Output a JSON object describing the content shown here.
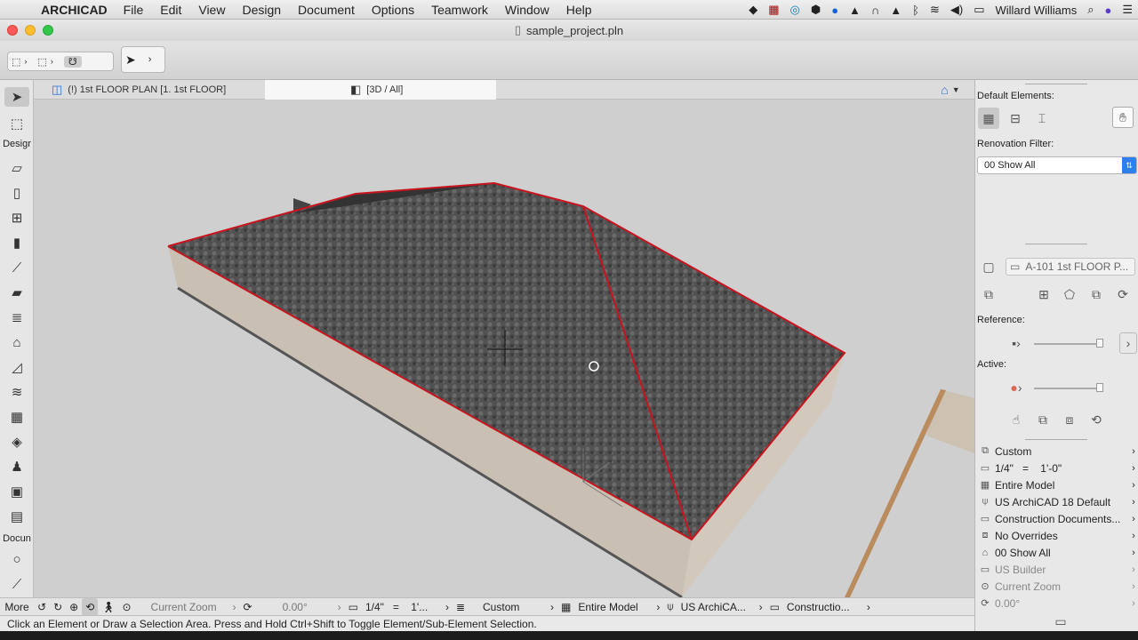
{
  "menubar": {
    "app_name": "ARCHICAD",
    "menus": [
      "File",
      "Edit",
      "View",
      "Design",
      "Document",
      "Options",
      "Teamwork",
      "Window",
      "Help"
    ],
    "user": "Willard Williams"
  },
  "window": {
    "title": "sample_project.pln"
  },
  "tabs": [
    {
      "label": "(!) 1st FLOOR PLAN [1. 1st FLOOR]"
    },
    {
      "label": "[3D / All]"
    }
  ],
  "toolbox": {
    "design_label": "Desigr",
    "document_label": "Docun",
    "more_label": "More"
  },
  "right_panel": {
    "default_elements_label": "Default Elements:",
    "renovation_filter_label": "Renovation Filter:",
    "renovation_filter_value": "00 Show All",
    "layout_sheet": "A-101 1st FLOOR P...",
    "reference_label": "Reference:",
    "active_label": "Active:",
    "quick_options": [
      {
        "icon": "layer-combination-icon",
        "label": "Custom"
      },
      {
        "icon": "scale-icon",
        "label": "1/4\"   =    1'-0\""
      },
      {
        "icon": "structure-display-icon",
        "label": "Entire Model"
      },
      {
        "icon": "pen-set-icon",
        "label": "US ArchiCAD 18 Default"
      },
      {
        "icon": "model-view-icon",
        "label": "Construction Documents..."
      },
      {
        "icon": "graphic-override-icon",
        "label": "No Overrides"
      },
      {
        "icon": "renovation-icon",
        "label": "00 Show All"
      },
      {
        "icon": "dimension-icon",
        "label": "US Builder"
      },
      {
        "icon": "zoom-icon",
        "label": "Current Zoom"
      },
      {
        "icon": "rotation-icon",
        "label": "0.00°"
      }
    ]
  },
  "bottom_bar": {
    "zoom": "Current Zoom",
    "angle": "0.00°",
    "scale": "1/4\"   =    1'...",
    "layers": "Custom",
    "model": "Entire Model",
    "penset": "US ArchiCA...",
    "mvo": "Constructio..."
  },
  "status_message": "Click an Element or Draw a Selection Area. Press and Hold Ctrl+Shift to Toggle Element/Sub-Element Selection.",
  "colors": {
    "roof_outline": "#c8141e",
    "selection_blue": "#2e7ef0"
  }
}
